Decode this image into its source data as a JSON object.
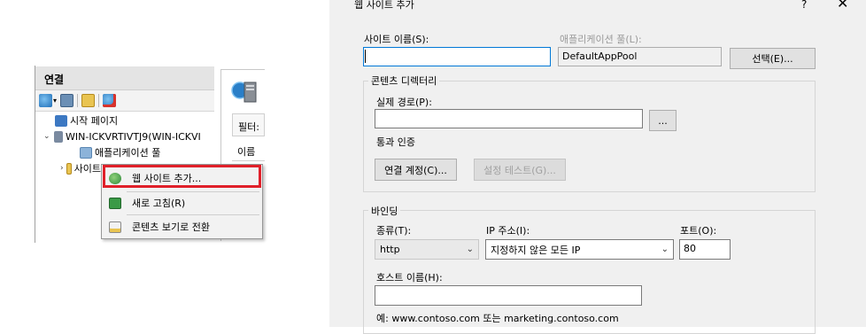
{
  "connections": {
    "title": "연결",
    "tree": {
      "start_page": "시작 페이지",
      "server": "WIN-ICKVRTIVTJ9(WIN-ICKVI",
      "app_pools": "애플리케이션 풀",
      "sites": "사이트"
    }
  },
  "features_pane": {
    "filter_label": "필터:",
    "name_column": "이름"
  },
  "context_menu": {
    "items": [
      {
        "label": "웹 사이트 추가..."
      },
      {
        "label": "새로 고침(R)"
      },
      {
        "label": "콘텐츠 보기로 전환"
      }
    ]
  },
  "dialog": {
    "title": "웹 사이트 추가",
    "help": "?",
    "close": "✕",
    "site_name_label": "사이트 이름(S):",
    "site_name_value": "",
    "app_pool_label": "애플리케이션 풀(L):",
    "app_pool_value": "DefaultAppPool",
    "select_button": "선택(E)...",
    "content_directory": {
      "group_title": "콘텐츠 디렉터리",
      "physical_path_label": "실제 경로(P):",
      "physical_path_value": "",
      "browse_button": "...",
      "pass_through_label": "통과 인증",
      "connect_as_button": "연결 계정(C)...",
      "test_settings_button": "설정 테스트(G)..."
    },
    "binding": {
      "group_title": "바인딩",
      "type_label": "종류(T):",
      "type_value": "http",
      "ip_label": "IP 주소(I):",
      "ip_value": "지정하지 않은 모든 IP",
      "port_label": "포트(O):",
      "port_value": "80",
      "host_label": "호스트 이름(H):",
      "host_value": "",
      "example": "예: www.contoso.com 또는 marketing.contoso.com"
    }
  },
  "colors": {
    "highlight_border": "#e0202a",
    "dialog_bg": "#f0f0f0",
    "panel_header": "#e4e4e4"
  }
}
